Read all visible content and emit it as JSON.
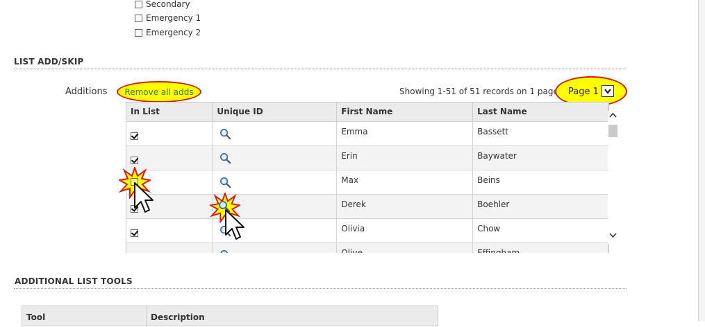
{
  "channels": {
    "items": [
      {
        "label": "Secondary",
        "checked": false
      },
      {
        "label": "Emergency 1",
        "checked": false
      },
      {
        "label": "Emergency 2",
        "checked": false
      }
    ]
  },
  "list_add_skip": {
    "title": "LIST ADD/SKIP",
    "additions_label": "Additions",
    "remove_all_label": "Remove all adds",
    "showing_text": "Showing 1-51 of 51 records on 1 pages.",
    "page_label": "Page 1",
    "columns": [
      "In List",
      "Unique ID",
      "First Name",
      "Last Name"
    ],
    "rows": [
      {
        "in_list": true,
        "first": "Emma",
        "last": "Bassett"
      },
      {
        "in_list": true,
        "first": "Erin",
        "last": "Baywater"
      },
      {
        "in_list": false,
        "first": "Max",
        "last": "Beins"
      },
      {
        "in_list": true,
        "first": "Derek",
        "last": "Boehler"
      },
      {
        "in_list": true,
        "first": "Olivia",
        "last": "Chow"
      },
      {
        "in_list": false,
        "first": "Olive",
        "last": "Effingham"
      }
    ]
  },
  "additional_tools": {
    "title": "ADDITIONAL LIST TOOLS",
    "columns": [
      "Tool",
      "Description"
    ]
  },
  "icons": {
    "magnifier": "magnifier-icon",
    "cursor": "mouse-pointer-icon",
    "highlight": "starburst-highlight",
    "dropdown": "chevron-down-icon"
  },
  "colors": {
    "highlight_fill": "#ffff00",
    "highlight_stroke": "#d61a1a",
    "link": "#2e7d1a",
    "header_bg": "#ebebeb"
  }
}
